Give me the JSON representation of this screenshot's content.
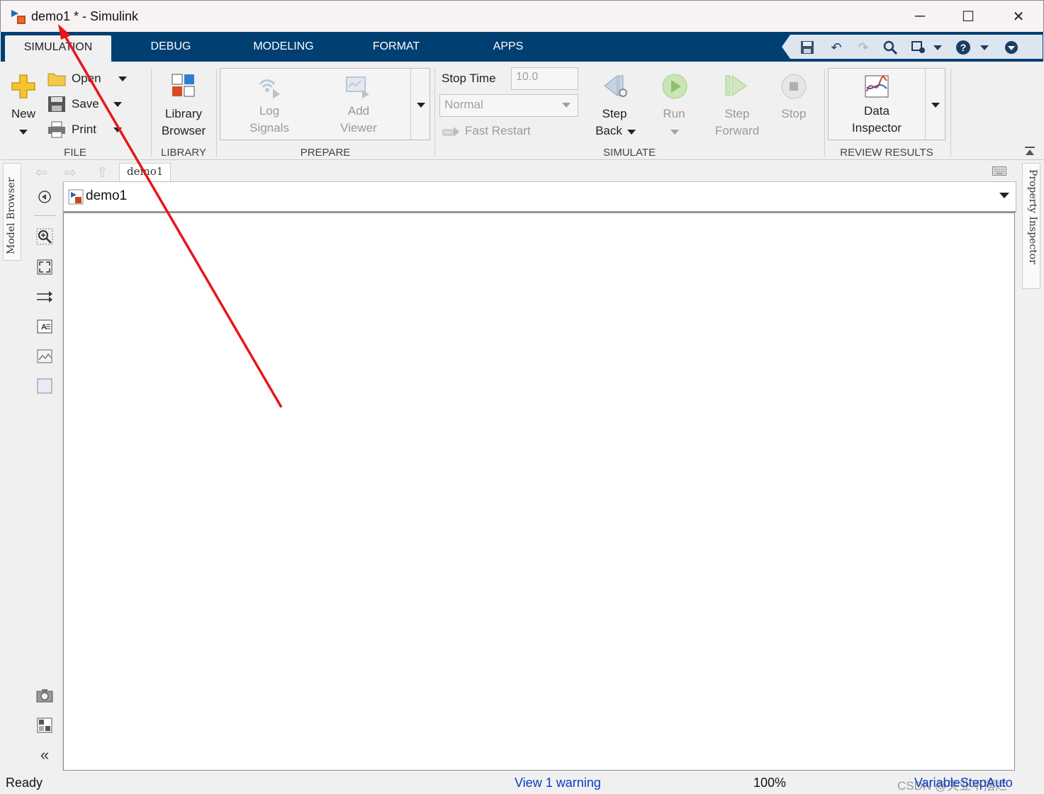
{
  "window": {
    "title": "demo1 * - Simulink",
    "minimize_label": "─",
    "maximize_label": "☐",
    "close_label": "✕"
  },
  "tabs": [
    {
      "label": "SIMULATION",
      "active": true
    },
    {
      "label": "DEBUG"
    },
    {
      "label": "MODELING"
    },
    {
      "label": "FORMAT"
    },
    {
      "label": "APPS"
    }
  ],
  "quick_access": [
    "save-icon",
    "undo-icon",
    "redo-icon",
    "search-icon",
    "customize-icon",
    "help-icon",
    "collapse-ribbon-icon"
  ],
  "ribbon": {
    "file": {
      "group_label": "FILE",
      "new_label": "New",
      "open_label": "Open",
      "save_label": "Save",
      "print_label": "Print"
    },
    "library": {
      "group_label": "LIBRARY",
      "library_browser_line1": "Library",
      "library_browser_line2": "Browser"
    },
    "prepare": {
      "group_label": "PREPARE",
      "log_signals_line1": "Log",
      "log_signals_line2": "Signals",
      "add_viewer_line1": "Add",
      "add_viewer_line2": "Viewer"
    },
    "simulate": {
      "group_label": "SIMULATE",
      "stop_time_label": "Stop Time",
      "stop_time_value": "10.0",
      "mode_value": "Normal",
      "fast_restart_label": "Fast Restart",
      "step_back_line1": "Step",
      "step_back_line2": "Back",
      "run_label": "Run",
      "step_forward_line1": "Step",
      "step_forward_line2": "Forward",
      "stop_label": "Stop"
    },
    "review": {
      "group_label": "REVIEW RESULTS",
      "data_inspector_line1": "Data",
      "data_inspector_line2": "Inspector"
    }
  },
  "side_panels": {
    "left": "Model Browser",
    "right": "Property Inspector"
  },
  "breadcrumb": "demo1",
  "address_bar": {
    "model_name": "demo1"
  },
  "status_bar": {
    "ready": "Ready",
    "warning_link": "View 1 warning",
    "zoom": "100%",
    "solver": "VariableStepAuto",
    "watermark": "CSDN @失业不摆烂"
  },
  "colors": {
    "ribbon_tab_bg": "#003f72",
    "link": "#0a3cc2",
    "annotation_arrow": "#e8161b"
  }
}
